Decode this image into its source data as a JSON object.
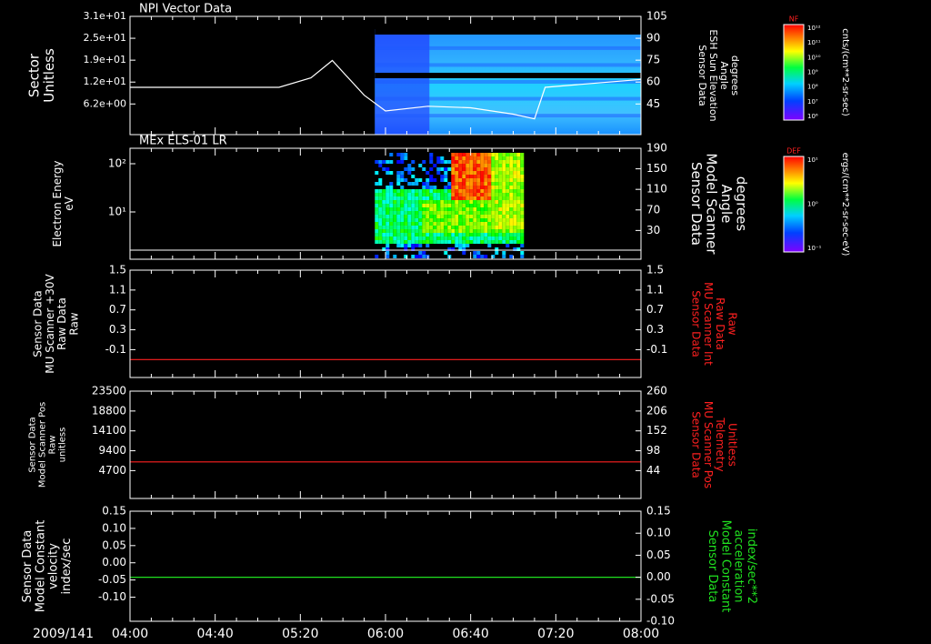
{
  "figure": {
    "time_label": "2009/141",
    "x_ticks": [
      "04:00",
      "04:40",
      "05:20",
      "06:00",
      "06:40",
      "07:20",
      "08:00"
    ],
    "colors": {
      "background": "#000000",
      "axes": "#ffffff",
      "red": "#ff2020",
      "green": "#20e020"
    }
  },
  "panels": [
    {
      "title": "NPI Vector Data",
      "left_label": [
        "Sector",
        "Unitless"
      ],
      "left_ticks": [
        "3.1e+01",
        "2.5e+01",
        "1.9e+01",
        "1.2e+01",
        "6.2e+00"
      ],
      "right_label": [
        "Sensor Data",
        "ESH Sun Elevation",
        "Angle",
        "degrees"
      ],
      "right_ticks": [
        "105",
        "90",
        "75",
        "60",
        "45"
      ],
      "colorbar": {
        "title": "NF",
        "label": "cnts/(cm**2-sr-sec)",
        "ticks": [
          "10¹²",
          "10¹¹",
          "10¹⁰",
          "10⁹",
          "10⁸",
          "10⁷",
          "10⁶"
        ]
      }
    },
    {
      "title": "MEx ELS-01 LR",
      "left_label": [
        "Electron Energy",
        "eV"
      ],
      "left_ticks": [
        "10²",
        "10¹"
      ],
      "right_label": [
        "Sensor Data",
        "Model Scanner",
        "Angle",
        "degrees"
      ],
      "right_ticks": [
        "190",
        "150",
        "110",
        "70",
        "30"
      ],
      "colorbar": {
        "title": "DEF",
        "label": "ergs/(cm**2-sr-sec-eV)",
        "ticks": [
          "10¹",
          "10⁰",
          "10⁻¹"
        ]
      }
    },
    {
      "left_label": [
        "Sensor Data",
        "MU Scanner +30V",
        "Raw Data",
        "Raw"
      ],
      "left_ticks": [
        "1.5",
        "1.1",
        "0.7",
        "0.3",
        "-0.1"
      ],
      "right_label": [
        "Sensor Data",
        "MU Scanner Int",
        "Raw Data",
        "Raw"
      ],
      "right_ticks": [
        "1.5",
        "1.1",
        "0.7",
        "0.3",
        "-0.1"
      ]
    },
    {
      "left_label": [
        "Sensor Data",
        "Model Scanner Pos",
        "Raw",
        "unitless"
      ],
      "left_ticks": [
        "23500",
        "18800",
        "14100",
        "9400",
        "4700"
      ],
      "right_label": [
        "Sensor Data",
        "MU Scanner Pos",
        "Telemetry",
        "Unitless"
      ],
      "right_ticks": [
        "260",
        "206",
        "152",
        "98",
        "44"
      ]
    },
    {
      "left_label": [
        "Sensor Data",
        "Model Constant",
        "velocity",
        "index/sec"
      ],
      "left_ticks": [
        "0.15",
        "0.10",
        "0.05",
        "0.00",
        "-0.05",
        "-0.10"
      ],
      "right_label": [
        "Sensor Data",
        "Model Constant",
        "acceleration",
        "index/sec**2"
      ],
      "right_ticks": [
        "0.15",
        "0.10",
        "0.05",
        "0.00",
        "-0.05",
        "-0.10"
      ]
    }
  ],
  "chart_data": [
    {
      "type": "heatmap",
      "title": "NPI Vector Data",
      "ylabel": "Sector Unitless",
      "x_range": [
        "04:00",
        "08:00"
      ],
      "data_span": [
        "05:55",
        "08:00"
      ],
      "overlay_line": {
        "label": "Sensor Data ESH Sun Elevation Angle degrees",
        "x": [
          "04:00",
          "05:10",
          "05:25",
          "05:35",
          "05:50",
          "06:00",
          "06:20",
          "06:40",
          "07:00",
          "07:10",
          "07:15",
          "08:00"
        ],
        "y": [
          60,
          60,
          66,
          77,
          55,
          45,
          48,
          47,
          43,
          40,
          60,
          65
        ]
      }
    },
    {
      "type": "heatmap",
      "title": "MEx ELS-01 LR",
      "ylabel": "Electron Energy eV",
      "y_scale": "log",
      "x_range": [
        "04:00",
        "08:00"
      ],
      "data_span": [
        "05:55",
        "07:05"
      ],
      "peak_span": [
        "06:30",
        "06:48"
      ],
      "overlay_line": {
        "label": "Sensor Data Model Scanner Angle degrees",
        "x": [
          "04:00",
          "08:00"
        ],
        "y": [
          20,
          20
        ]
      }
    },
    {
      "type": "line",
      "x": [
        "04:00",
        "08:00"
      ],
      "series": [
        {
          "values": [
            0.0,
            0.0
          ],
          "color": "#ff2020"
        }
      ],
      "ylim": [
        -0.3,
        1.5
      ]
    },
    {
      "type": "line",
      "x": [
        "04:00",
        "08:00"
      ],
      "series": [
        {
          "values": [
            8000,
            8000
          ],
          "color": "#ff2020"
        }
      ],
      "ylim": [
        0,
        23500
      ]
    },
    {
      "type": "line",
      "x": [
        "04:00",
        "08:00"
      ],
      "series": [
        {
          "values": [
            0.0,
            0.0
          ],
          "color": "#20e020"
        }
      ],
      "ylim": [
        -0.1,
        0.15
      ]
    }
  ]
}
